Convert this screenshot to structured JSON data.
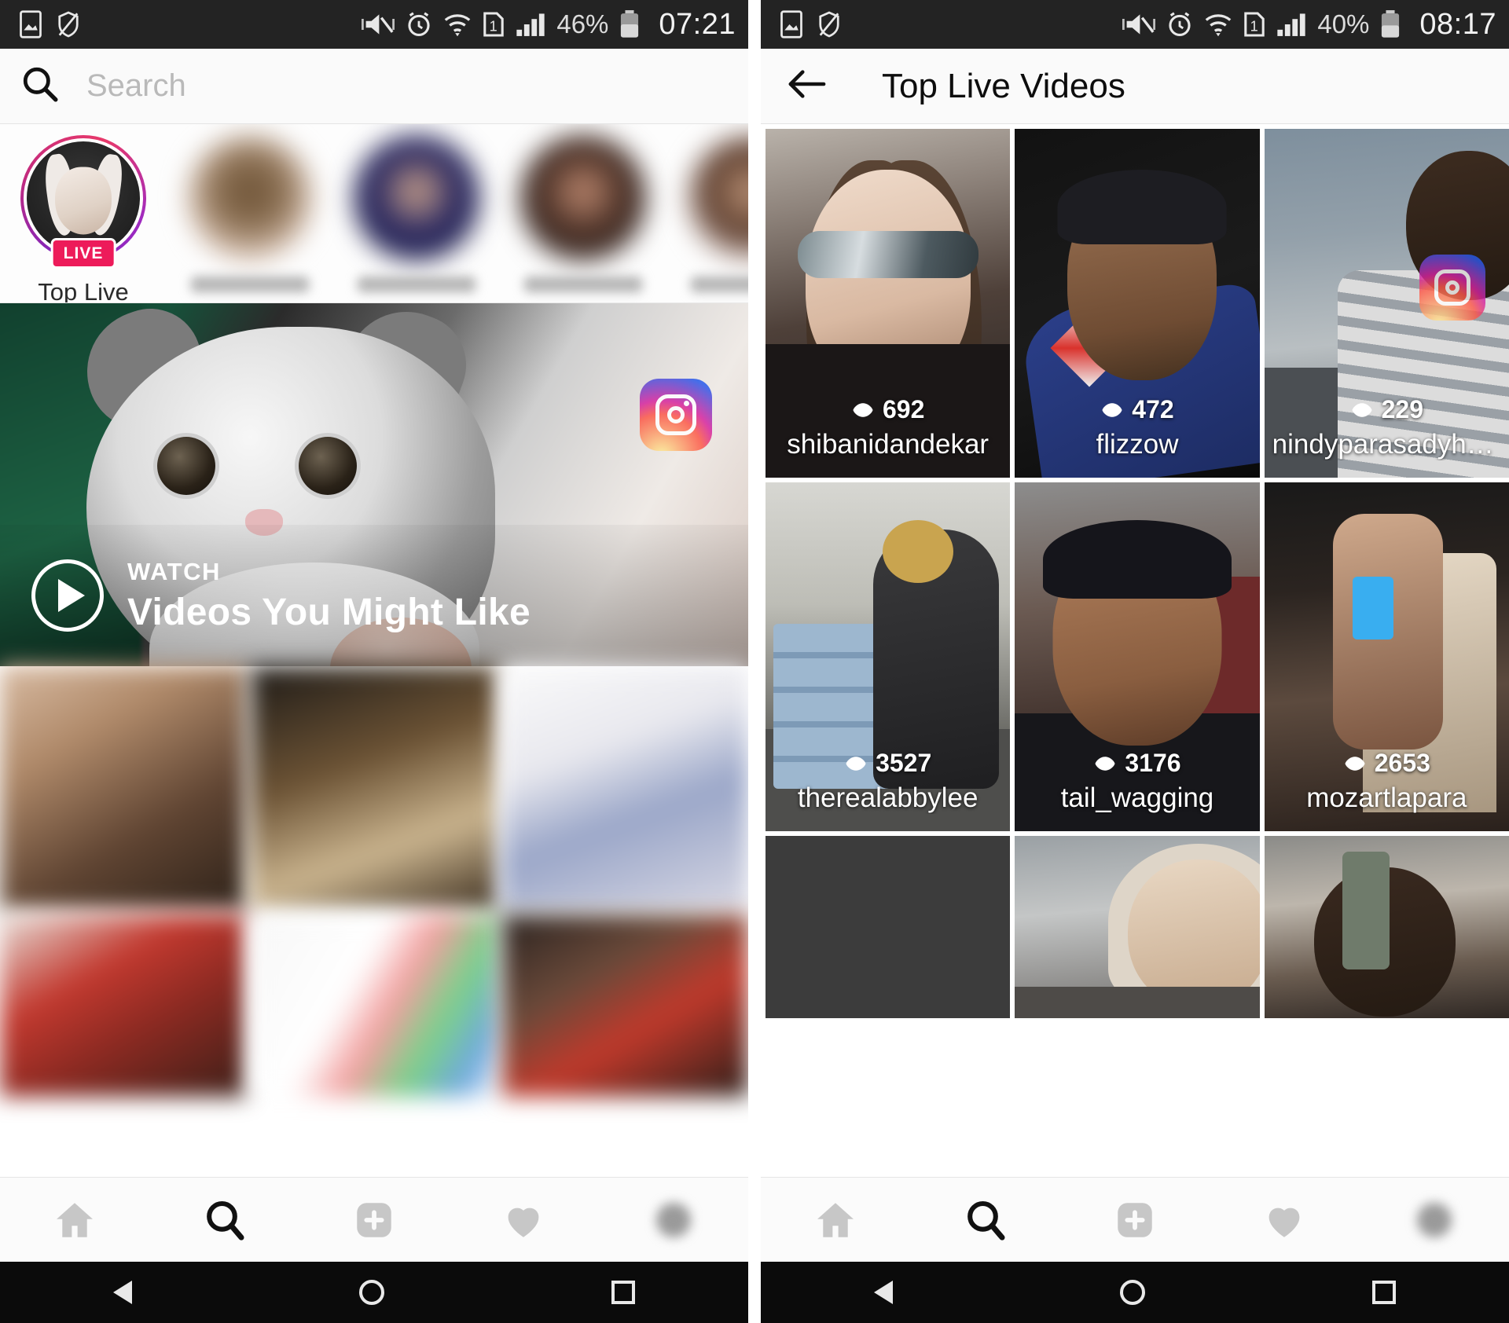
{
  "left_screen": {
    "status_bar": {
      "icons": [
        "image-icon",
        "shield-off-icon",
        "vibrate-mute-icon",
        "alarm-icon",
        "wifi-icon",
        "sim-1-icon",
        "signal-icon"
      ],
      "battery_percent": "46%",
      "time": "07:21"
    },
    "search": {
      "placeholder": "Search",
      "icon": "search-icon"
    },
    "stories": [
      {
        "label": "Top Live",
        "badge": "LIVE",
        "blurred": false
      },
      {
        "label": "",
        "badge": "",
        "blurred": true
      },
      {
        "label": "",
        "badge": "",
        "blurred": true
      },
      {
        "label": "",
        "badge": "",
        "blurred": true
      },
      {
        "label": "",
        "badge": "",
        "blurred": true
      }
    ],
    "hero_card": {
      "kicker": "WATCH",
      "title": "Videos You Might Like",
      "play_icon": "play-icon",
      "watermark": "instagram-icon"
    },
    "explore_grid_rows": 2,
    "bottom_nav": [
      {
        "icon": "home-icon",
        "active": false
      },
      {
        "icon": "search-icon",
        "active": true
      },
      {
        "icon": "add-post-icon",
        "active": false
      },
      {
        "icon": "heart-icon",
        "active": false
      },
      {
        "icon": "profile-avatar-icon",
        "active": false
      }
    ],
    "system_nav": [
      "back-icon",
      "home-icon",
      "recents-icon"
    ]
  },
  "right_screen": {
    "status_bar": {
      "icons": [
        "image-icon",
        "shield-off-icon",
        "vibrate-mute-icon",
        "alarm-icon",
        "wifi-icon",
        "sim-1-icon",
        "signal-icon"
      ],
      "battery_percent": "40%",
      "time": "08:17"
    },
    "app_bar": {
      "back_icon": "back-arrow-icon",
      "title": "Top Live Videos"
    },
    "live_videos": [
      {
        "views": "692",
        "username": "shibanidandekar",
        "watermark": false
      },
      {
        "views": "472",
        "username": "flizzow",
        "watermark": false
      },
      {
        "views": "229",
        "username": "nindyparasadyha…",
        "watermark": true
      },
      {
        "views": "3527",
        "username": "therealabbylee",
        "watermark": false
      },
      {
        "views": "3176",
        "username": "tail_wagging",
        "watermark": false
      },
      {
        "views": "2653",
        "username": "mozartlapara",
        "watermark": false
      },
      {
        "views": "",
        "username": "",
        "watermark": false
      },
      {
        "views": "",
        "username": "",
        "watermark": false
      },
      {
        "views": "",
        "username": "",
        "watermark": false
      }
    ],
    "bottom_nav": [
      {
        "icon": "home-icon",
        "active": false
      },
      {
        "icon": "search-icon",
        "active": true
      },
      {
        "icon": "add-post-icon",
        "active": false
      },
      {
        "icon": "heart-icon",
        "active": false
      },
      {
        "icon": "profile-avatar-icon",
        "active": false
      }
    ],
    "system_nav": [
      "back-icon",
      "home-icon",
      "recents-icon"
    ]
  },
  "colors": {
    "status_bar_bg": "#232323",
    "app_bg": "#fafafa",
    "live_badge": "#ed1b5a",
    "text_primary": "#0d0d0d",
    "text_placeholder": "#b9b9b9"
  }
}
